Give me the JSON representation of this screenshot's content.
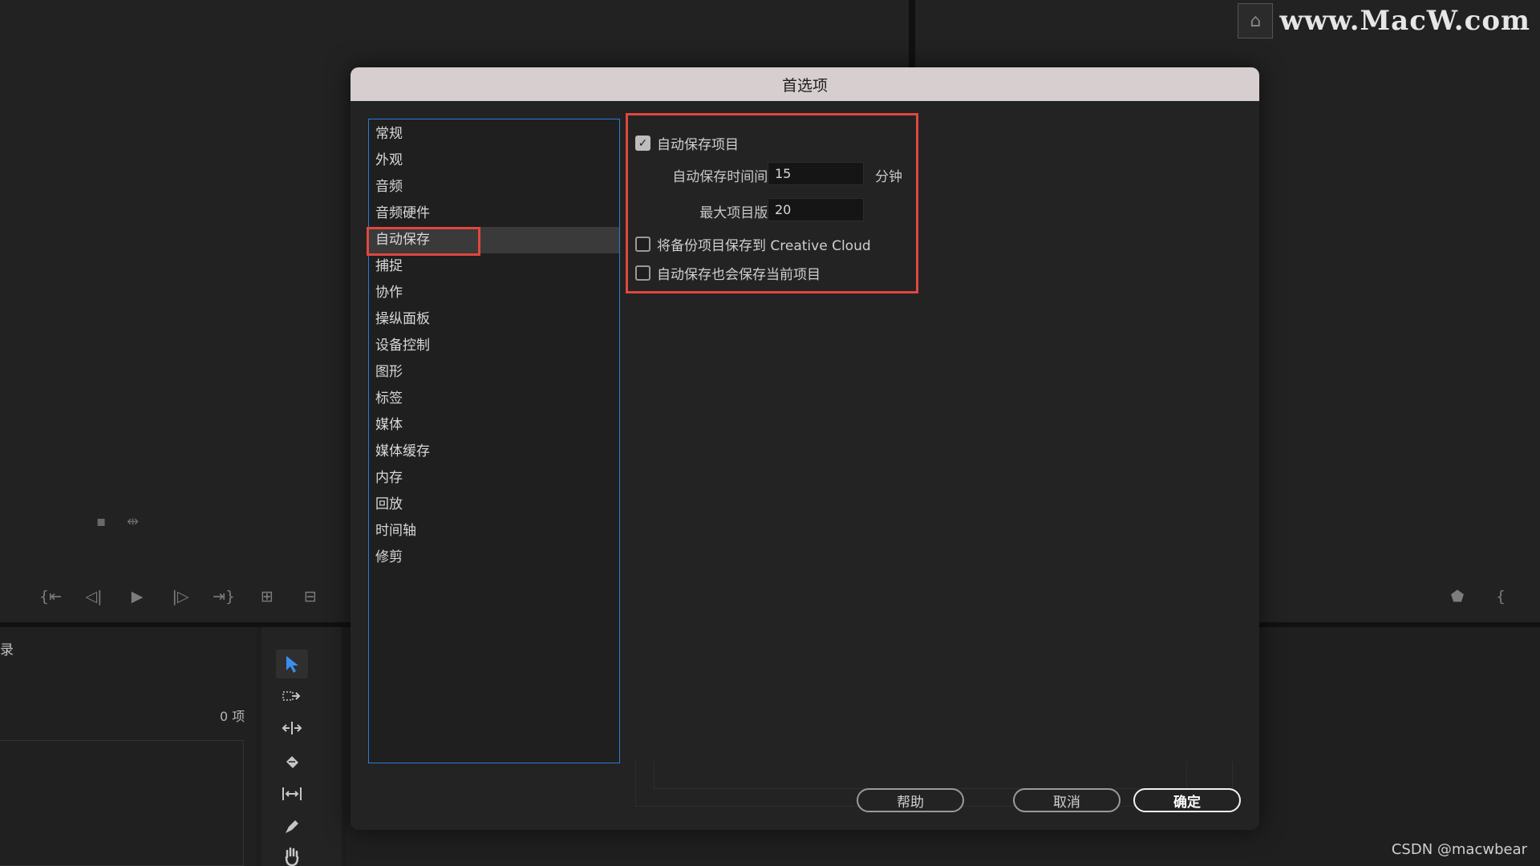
{
  "dialog": {
    "title": "首选项",
    "categories": [
      "常规",
      "外观",
      "音频",
      "音频硬件",
      "自动保存",
      "捕捉",
      "协作",
      "操纵面板",
      "设备控制",
      "图形",
      "标签",
      "媒体",
      "媒体缓存",
      "内存",
      "回放",
      "时间轴",
      "修剪"
    ],
    "selected_index": 4,
    "settings": {
      "autosave_projects": {
        "label": "自动保存项目",
        "checked": true
      },
      "interval": {
        "label": "自动保存时间间隔:",
        "value": "15",
        "unit": "分钟"
      },
      "max_versions": {
        "label": "最大项目版本:",
        "value": "20"
      },
      "backup_cc": {
        "label": "将备份项目保存到 Creative Cloud",
        "checked": false
      },
      "save_current": {
        "label": "自动保存也会保存当前项目",
        "checked": false
      }
    },
    "buttons": {
      "help": "帮助",
      "cancel": "取消",
      "ok": "确定"
    },
    "highlight_color": "#e0473f",
    "list_border_color": "#2d7bd6"
  },
  "project_panel": {
    "label": "录",
    "count": "0 项"
  },
  "watermark": {
    "text": "www.MacW.com"
  },
  "credit": "CSDN @macwbear"
}
